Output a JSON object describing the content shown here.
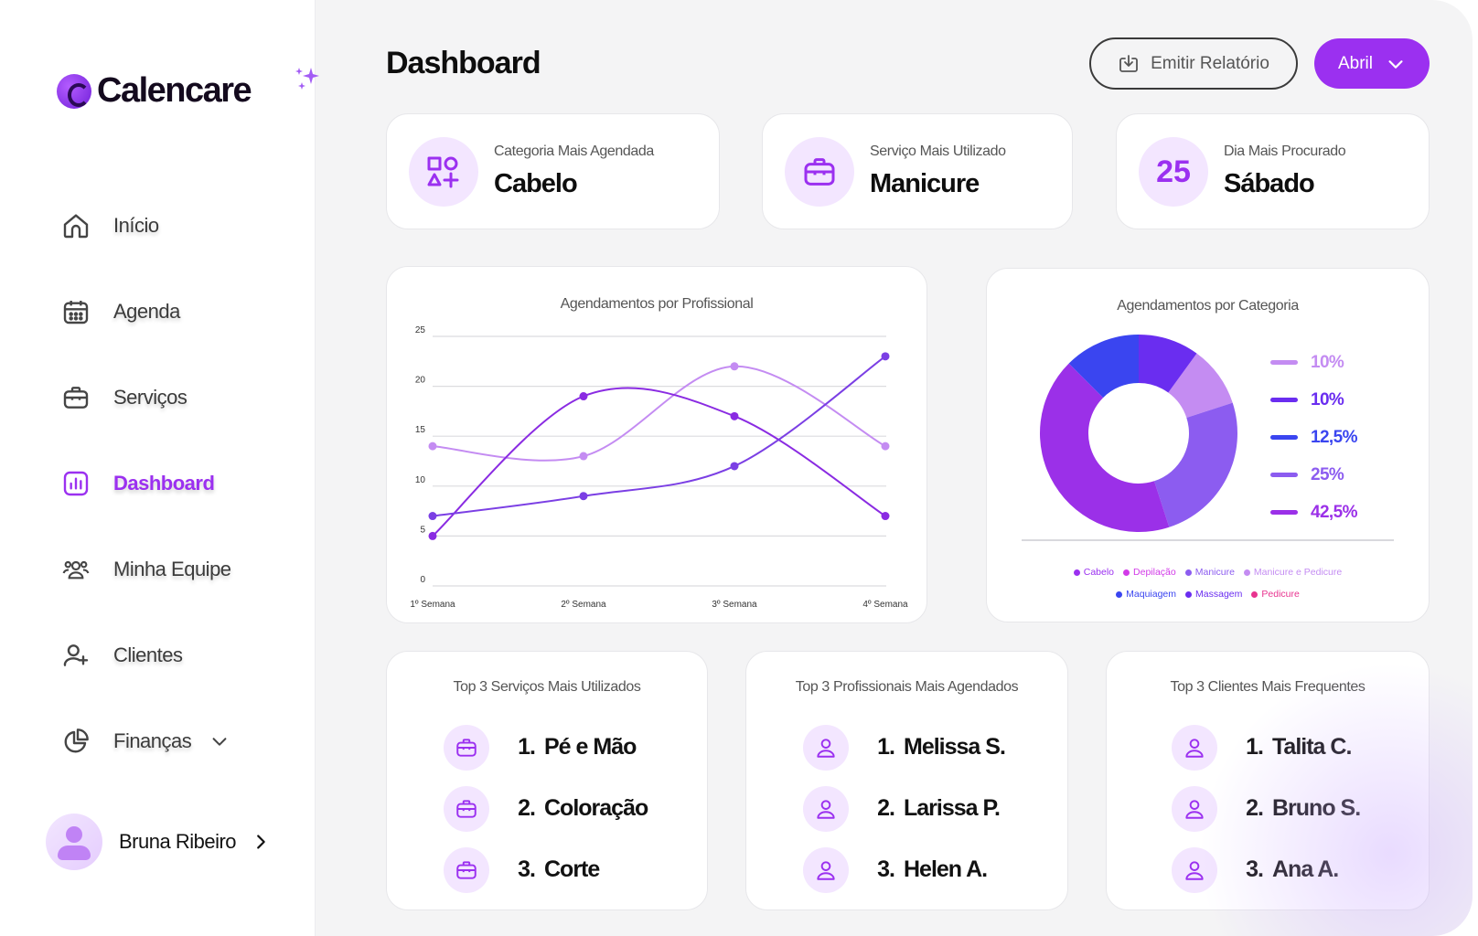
{
  "brand": {
    "name": "Calencare"
  },
  "sidebar": {
    "items": [
      {
        "label": "Início",
        "icon": "home-icon"
      },
      {
        "label": "Agenda",
        "icon": "calendar-icon"
      },
      {
        "label": "Serviços",
        "icon": "briefcase-icon"
      },
      {
        "label": "Dashboard",
        "icon": "bar-chart-icon",
        "active": true
      },
      {
        "label": "Minha Equipe",
        "icon": "team-icon"
      },
      {
        "label": "Clientes",
        "icon": "user-plus-icon"
      },
      {
        "label": "Finanças",
        "icon": "pie-chart-icon",
        "has_submenu": true
      }
    ],
    "profile": {
      "name": "Bruna Ribeiro"
    }
  },
  "header": {
    "title": "Dashboard",
    "report_button": "Emitir Relatório",
    "month_select": "Abril"
  },
  "stats": [
    {
      "label": "Categoria Mais Agendada",
      "value": "Cabelo",
      "icon": "shapes-icon"
    },
    {
      "label": "Serviço Mais Utilizado",
      "value": "Manicure",
      "icon": "briefcase-icon"
    },
    {
      "label": "Dia Mais Procurado",
      "value": "Sábado",
      "icon_text": "25"
    }
  ],
  "colors": {
    "accent": "#9b30f0",
    "accent_light": "#f3e6ff"
  },
  "chart_data": [
    {
      "type": "line",
      "title": "Agendamentos por Profissional",
      "categories": [
        "1º Semana",
        "2º Semana",
        "3º Semana",
        "4º Semana"
      ],
      "ylim": [
        0,
        25
      ],
      "yticks": [
        0,
        5,
        10,
        15,
        20,
        25
      ],
      "grid": true,
      "series": [
        {
          "values": [
            14,
            13,
            22,
            14
          ],
          "color": "#c48cf2"
        },
        {
          "values": [
            5,
            19,
            17,
            7
          ],
          "color": "#8a2be2"
        },
        {
          "values": [
            7,
            9,
            12,
            23
          ],
          "color": "#7b3fe4"
        }
      ]
    },
    {
      "type": "pie",
      "title": "Agendamentos por Categoria",
      "donut": true,
      "slices": [
        {
          "label": "10%",
          "value": 10,
          "color": "#c48cf2"
        },
        {
          "label": "10%",
          "value": 10,
          "color": "#6a2df0"
        },
        {
          "label": "12,5%",
          "value": 12.5,
          "color": "#3a45f0"
        },
        {
          "label": "25%",
          "value": 25,
          "color": "#8c5cf0"
        },
        {
          "label": "42,5%",
          "value": 42.5,
          "color": "#9b30e8"
        }
      ],
      "legend": [
        [
          {
            "label": "Cabelo",
            "color": "#9b30f0"
          },
          {
            "label": "Depilação",
            "color": "#d23ae8"
          },
          {
            "label": "Manicure",
            "color": "#8c5cf0"
          },
          {
            "label": "Manicure e Pedicure",
            "color": "#c48cf2"
          }
        ],
        [
          {
            "label": "Maquiagem",
            "color": "#3a45f0"
          },
          {
            "label": "Massagem",
            "color": "#6a2df0"
          },
          {
            "label": "Pedicure",
            "color": "#e8338f"
          }
        ]
      ]
    }
  ],
  "top_lists": [
    {
      "title": "Top 3 Serviços Mais Utilizados",
      "icon": "briefcase-icon",
      "items": [
        {
          "rank": "1.",
          "name": "Pé e Mão"
        },
        {
          "rank": "2.",
          "name": "Coloração"
        },
        {
          "rank": "3.",
          "name": "Corte"
        }
      ]
    },
    {
      "title": "Top 3 Profissionais Mais Agendados",
      "icon": "user-icon",
      "items": [
        {
          "rank": "1.",
          "name": "Melissa S."
        },
        {
          "rank": "2.",
          "name": "Larissa P."
        },
        {
          "rank": "3.",
          "name": "Helen A."
        }
      ]
    },
    {
      "title": "Top 3 Clientes Mais Frequentes",
      "icon": "user-icon",
      "items": [
        {
          "rank": "1.",
          "name": "Talita C."
        },
        {
          "rank": "2.",
          "name": "Bruno S."
        },
        {
          "rank": "3.",
          "name": "Ana A."
        }
      ]
    }
  ]
}
